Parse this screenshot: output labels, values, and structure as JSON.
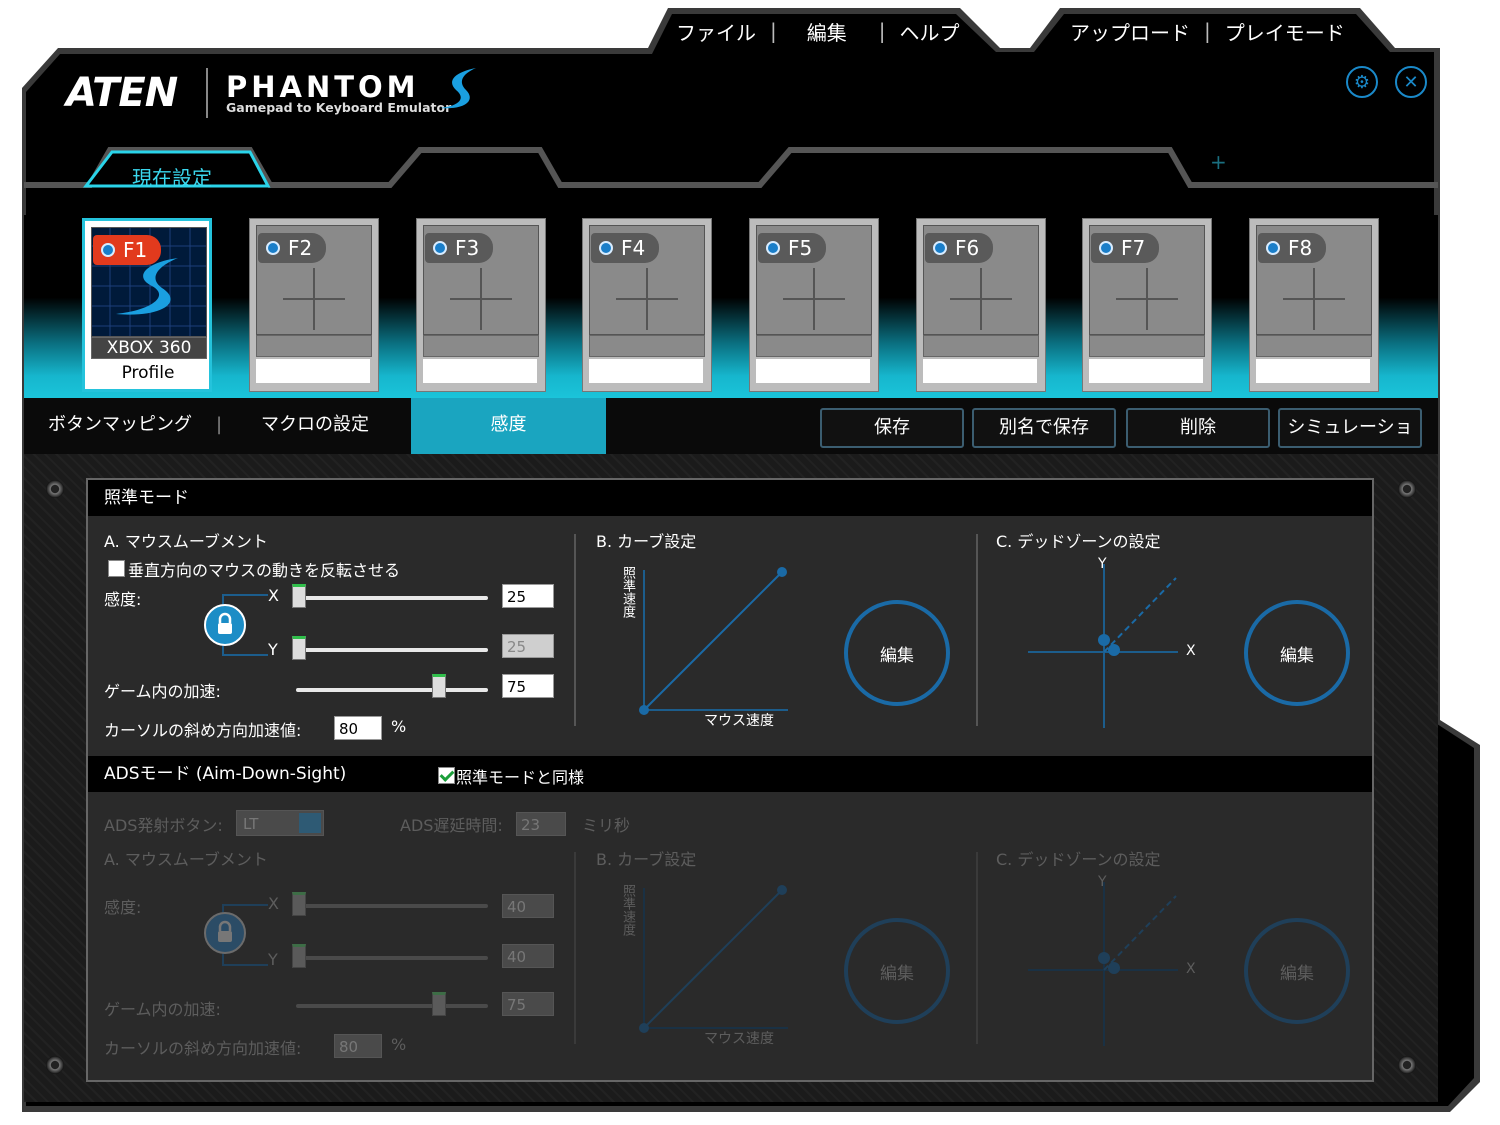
{
  "menu": {
    "file": "ファイル",
    "edit": "編集",
    "help": "ヘルプ",
    "upload": "アップロード",
    "playmode": "プレイモード"
  },
  "logo": {
    "brand": "ATEN",
    "product": "PHANTOM",
    "tagline": "Gamepad to Keyboard Emulator"
  },
  "icons": {
    "settings": "gear-icon",
    "close": "close-icon",
    "add_tab": "plus-icon"
  },
  "current_tab": "現在設定",
  "add_tab_symbol": "+",
  "profiles": [
    {
      "key": "F1",
      "name": "XBOX 360",
      "label": "Profile",
      "active": true
    },
    {
      "key": "F2",
      "name": "",
      "label": "",
      "active": false
    },
    {
      "key": "F3",
      "name": "",
      "label": "",
      "active": false
    },
    {
      "key": "F4",
      "name": "",
      "label": "",
      "active": false
    },
    {
      "key": "F5",
      "name": "",
      "label": "",
      "active": false
    },
    {
      "key": "F6",
      "name": "",
      "label": "",
      "active": false
    },
    {
      "key": "F7",
      "name": "",
      "label": "",
      "active": false
    },
    {
      "key": "F8",
      "name": "",
      "label": "",
      "active": false
    }
  ],
  "section_tabs": {
    "button_mapping": "ボタンマッピング",
    "macro": "マクロの設定",
    "sensitivity": "感度"
  },
  "actions": {
    "save": "保存",
    "save_as": "別名で保存",
    "delete": "削除",
    "simulation": "シミュレーション"
  },
  "aim": {
    "header": "照準モード",
    "a_title": "A. マウスムーブメント",
    "invert_label": "垂直方向のマウスの動きを反転させる",
    "invert_checked": false,
    "sensitivity_label": "感度:",
    "x_label": "X",
    "y_label": "Y",
    "x_value": "25",
    "y_value": "25",
    "accel_label": "ゲーム内の加速:",
    "accel_value": "75",
    "diag_label": "カーソルの斜め方向加速値:",
    "diag_value": "80",
    "percent": "%",
    "b_title": "B. カーブ設定",
    "curve_y_label": "照準速度",
    "curve_x_label": "マウス速度",
    "edit": "編集",
    "c_title": "C. デッドゾーンの設定",
    "dz_y": "Y",
    "dz_x": "X"
  },
  "ads": {
    "header": "ADSモード (Aim-Down-Sight)",
    "same_as_aim_label": "照準モードと同様",
    "same_as_aim_checked": true,
    "trigger_label": "ADS発射ボタン:",
    "trigger_value": "LT",
    "delay_label": "ADS遅延時間:",
    "delay_value": "23",
    "delay_unit": "ミリ秒",
    "a_title": "A. マウスムーブメント",
    "sensitivity_label": "感度:",
    "x_label": "X",
    "y_label": "Y",
    "x_value": "40",
    "y_value": "40",
    "accel_label": "ゲーム内の加速:",
    "accel_value": "75",
    "diag_label": "カーソルの斜め方向加速値:",
    "diag_value": "80",
    "percent": "%",
    "b_title": "B. カーブ設定",
    "curve_y_label": "照準速度",
    "curve_x_label": "マウス速度",
    "edit": "編集",
    "c_title": "C. デッドゾーンの設定",
    "dz_y": "Y",
    "dz_x": "X"
  },
  "colors": {
    "accent": "#1bc4da",
    "active_fkey": "#e23a1d",
    "circle": "#1a6aa6"
  }
}
